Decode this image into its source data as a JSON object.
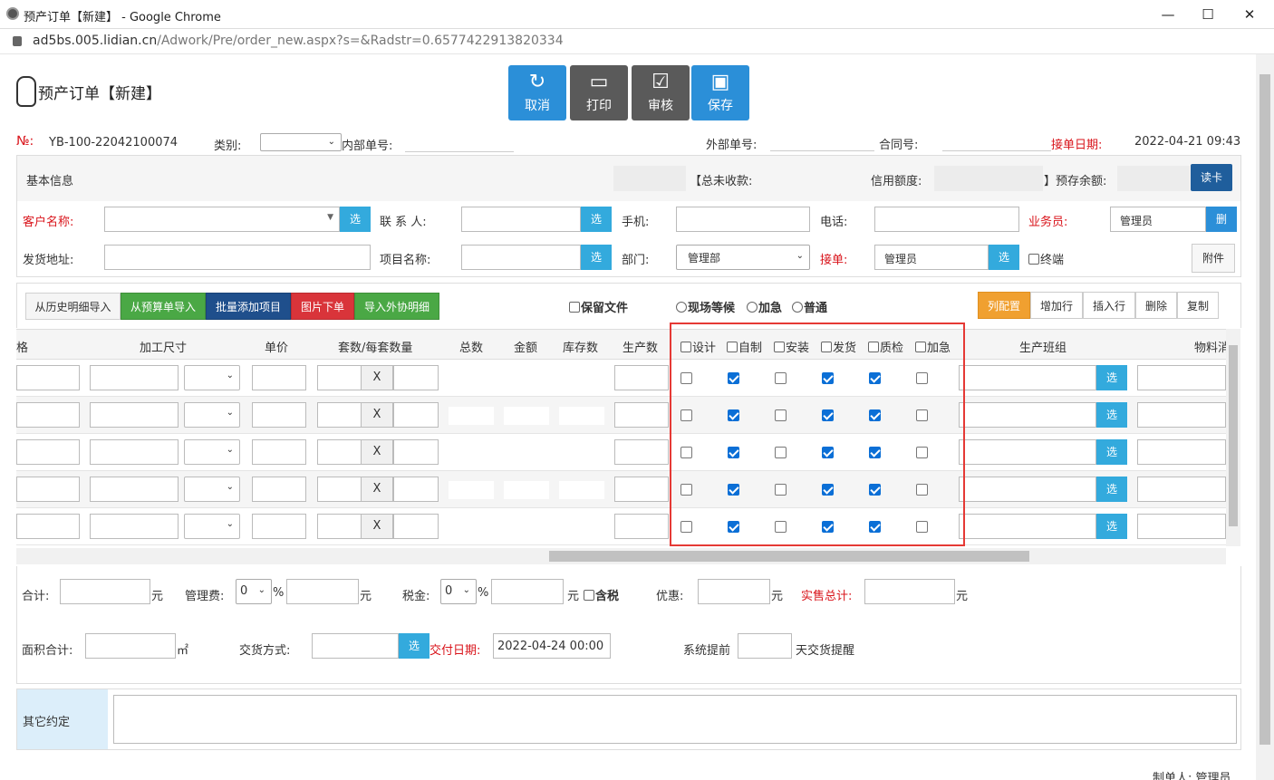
{
  "window": {
    "title": "预产订单【新建】 - Google Chrome",
    "url_host": "ad5bs.005.lidian.cn",
    "url_path": "/Adwork/Pre/order_new.aspx?s=&Radstr=0.6577422913820334"
  },
  "page": {
    "title": "预产订单【新建】"
  },
  "toolbar": {
    "cancel": "取消",
    "print": "打印",
    "review": "审核",
    "save": "保存"
  },
  "order": {
    "no_label": "№:",
    "no_value": "YB-100-22042100074",
    "category_label": "类别:",
    "internal_label": "内部单号:",
    "external_label": "外部单号:",
    "contract_label": "合同号:",
    "date_label": "接单日期:",
    "date_value": "2022-04-21 09:43"
  },
  "basic": {
    "title": "基本信息",
    "unpaid_label": "【总未收款:",
    "credit_label": "信用额度:",
    "prepaid_label": "】预存余额:",
    "readcard": "读卡"
  },
  "form": {
    "customer_label": "客户名称:",
    "contact_label": "联 系 人:",
    "mobile_label": "手机:",
    "phone_label": "电话:",
    "salesman_label": "业务员:",
    "salesman_value": "管理员",
    "delete_btn": "删",
    "address_label": "发货地址:",
    "project_label": "项目名称:",
    "dept_label": "部门:",
    "dept_value": "管理部",
    "receiver_label": "接单:",
    "receiver_value": "管理员",
    "terminal_label": "终端",
    "attach": "附件",
    "select_btn": "选"
  },
  "detail_toolbar": {
    "import_history": "从历史明细导入",
    "import_budget": "从预算单导入",
    "batch_add": "批量添加项目",
    "image_order": "图片下单",
    "import_outsource": "导入外协明细",
    "keep_file": "保留文件",
    "onsite": "现场等候",
    "urgent": "加急",
    "normal": "普通",
    "column_config": "列配置",
    "add_row": "增加行",
    "insert_row": "插入行",
    "delete": "删除",
    "copy": "复制"
  },
  "grid": {
    "headers": [
      "格",
      "加工尺寸",
      "单价",
      "套数/每套数量",
      "总数",
      "金额",
      "库存数",
      "生产数",
      "设计",
      "自制",
      "安装",
      "发货",
      "质检",
      "加急",
      "生产班组",
      "物料消"
    ],
    "x_label": "X",
    "rows": [
      [
        false,
        true,
        false,
        true,
        true,
        false
      ],
      [
        false,
        true,
        false,
        true,
        true,
        false
      ],
      [
        false,
        true,
        false,
        true,
        true,
        false
      ],
      [
        false,
        true,
        false,
        true,
        true,
        false
      ],
      [
        false,
        true,
        false,
        true,
        true,
        false
      ]
    ]
  },
  "totals": {
    "sum_label": "合计:",
    "yuan": "元",
    "mgmt_label": "管理费:",
    "mgmt_value": "0",
    "pct": "%",
    "tax_label": "税金:",
    "tax_value": "0",
    "tax_incl": "含税",
    "discount_label": "优惠:",
    "actual_label": "实售总计:",
    "area_label": "面积合计:",
    "area_unit": "㎡",
    "delivery_label": "交货方式:",
    "due_label": "交付日期:",
    "due_value": "2022-04-24 00:00",
    "remind_prefix": "系统提前",
    "remind_suffix": "天交货提醒"
  },
  "other": {
    "label": "其它约定",
    "maker": "制单人: 管理员"
  }
}
